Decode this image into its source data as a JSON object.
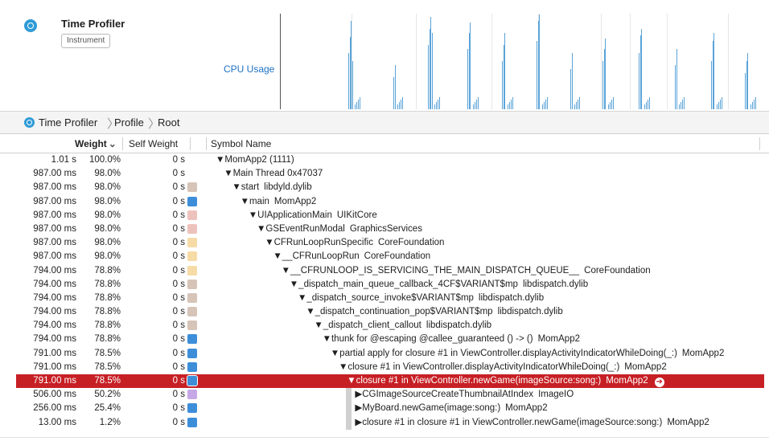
{
  "instrument": {
    "title": "Time Profiler",
    "badge": "Instrument",
    "track_label": "CPU Usage",
    "accent_color": "#2f9bd6",
    "graph_color": "#5aa3d8"
  },
  "breadcrumb": [
    "Time Profiler",
    "Profile",
    "Root"
  ],
  "columns": {
    "weight": "Weight",
    "weight_sort": "⌄",
    "self_weight": "Self Weight",
    "symbol": "Symbol Name"
  },
  "rows": [
    {
      "ms": "1.01 s",
      "pct": "100.0%",
      "self": "",
      "icon": "",
      "sym": "▼MomApp2 (1111)",
      "lib": "",
      "indent": 0,
      "sel": false
    },
    {
      "ms": "987.00 ms",
      "pct": "98.0%",
      "self": "0 s",
      "icon": "",
      "sym": "▼Main Thread  0x47037",
      "lib": "",
      "indent": 1,
      "sel": false
    },
    {
      "ms": "987.00 ms",
      "pct": "98.0%",
      "self": "0 s",
      "icon": "gear",
      "sym": "▼start",
      "lib": "libdyld.dylib",
      "indent": 2,
      "sel": false
    },
    {
      "ms": "987.00 ms",
      "pct": "98.0%",
      "self": "0 s",
      "icon": "user",
      "sym": "▼main",
      "lib": "MomApp2",
      "indent": 3,
      "sel": false
    },
    {
      "ms": "987.00 ms",
      "pct": "98.0%",
      "self": "0 s",
      "icon": "lib",
      "sym": "▼UIApplicationMain",
      "lib": "UIKitCore",
      "indent": 4,
      "sel": false
    },
    {
      "ms": "987.00 ms",
      "pct": "98.0%",
      "self": "0 s",
      "icon": "lib",
      "sym": "▼GSEventRunModal",
      "lib": "GraphicsServices",
      "indent": 5,
      "sel": false
    },
    {
      "ms": "987.00 ms",
      "pct": "98.0%",
      "self": "0 s",
      "icon": "core",
      "sym": "▼CFRunLoopRunSpecific",
      "lib": "CoreFoundation",
      "indent": 6,
      "sel": false
    },
    {
      "ms": "987.00 ms",
      "pct": "98.0%",
      "self": "0 s",
      "icon": "core",
      "sym": "▼__CFRunLoopRun",
      "lib": "CoreFoundation",
      "indent": 7,
      "sel": false
    },
    {
      "ms": "794.00 ms",
      "pct": "78.8%",
      "self": "0 s",
      "icon": "core",
      "sym": "▼__CFRUNLOOP_IS_SERVICING_THE_MAIN_DISPATCH_QUEUE__",
      "lib": "CoreFoundation",
      "indent": 8,
      "sel": false
    },
    {
      "ms": "794.00 ms",
      "pct": "78.8%",
      "self": "0 s",
      "icon": "gear",
      "sym": "▼_dispatch_main_queue_callback_4CF$VARIANT$mp",
      "lib": "libdispatch.dylib",
      "indent": 9,
      "sel": false
    },
    {
      "ms": "794.00 ms",
      "pct": "78.8%",
      "self": "0 s",
      "icon": "gear",
      "sym": "▼_dispatch_source_invoke$VARIANT$mp",
      "lib": "libdispatch.dylib",
      "indent": 10,
      "sel": false
    },
    {
      "ms": "794.00 ms",
      "pct": "78.8%",
      "self": "0 s",
      "icon": "gear",
      "sym": "▼_dispatch_continuation_pop$VARIANT$mp",
      "lib": "libdispatch.dylib",
      "indent": 11,
      "sel": false
    },
    {
      "ms": "794.00 ms",
      "pct": "78.8%",
      "self": "0 s",
      "icon": "gear",
      "sym": "▼_dispatch_client_callout",
      "lib": "libdispatch.dylib",
      "indent": 12,
      "sel": false
    },
    {
      "ms": "794.00 ms",
      "pct": "78.8%",
      "self": "0 s",
      "icon": "user",
      "sym": "▼thunk for @escaping @callee_guaranteed () -> ()",
      "lib": "MomApp2",
      "indent": 13,
      "sel": false
    },
    {
      "ms": "791.00 ms",
      "pct": "78.5%",
      "self": "0 s",
      "icon": "user",
      "sym": "▼partial apply for closure #1 in ViewController.displayActivityIndicatorWhileDoing(_:)",
      "lib": "MomApp2",
      "indent": 14,
      "sel": false
    },
    {
      "ms": "791.00 ms",
      "pct": "78.5%",
      "self": "0 s",
      "icon": "user",
      "sym": "▼closure #1 in ViewController.displayActivityIndicatorWhileDoing(_:)",
      "lib": "MomApp2",
      "indent": 15,
      "sel": false
    },
    {
      "ms": "791.00 ms",
      "pct": "78.5%",
      "self": "0 s",
      "icon": "user",
      "sym": "▼closure #1 in ViewController.newGame(imageSource:song:)",
      "lib": "MomApp2",
      "indent": 16,
      "sel": true
    },
    {
      "ms": "506.00 ms",
      "pct": "50.2%",
      "self": "0 s",
      "icon": "imgio",
      "sym": "▶CGImageSourceCreateThumbnailAtIndex",
      "lib": "ImageIO",
      "indent": 17,
      "sel": false
    },
    {
      "ms": "256.00 ms",
      "pct": "25.4%",
      "self": "0 s",
      "icon": "user",
      "sym": "▶MyBoard.newGame(image:song:)",
      "lib": "MomApp2",
      "indent": 17,
      "sel": false
    },
    {
      "ms": "13.00 ms",
      "pct": "1.2%",
      "self": "0 s",
      "icon": "user",
      "sym": "▶closure #1 in closure #1 in ViewController.newGame(imageSource:song:)",
      "lib": "MomApp2",
      "indent": 17,
      "sel": false
    }
  ],
  "selection_color": "#c62025"
}
